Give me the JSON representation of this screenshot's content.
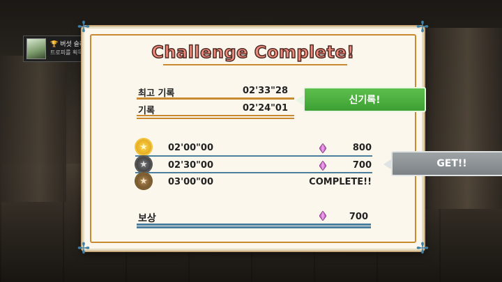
{
  "notification": {
    "trophy_name": "버섯 슬라이더",
    "message": "트로피를 획득했습니다!",
    "platform_badge": "PS"
  },
  "panel": {
    "title": "Challenge Complete!",
    "records": [
      {
        "label": "최고 기록",
        "time": "02'33\"28"
      },
      {
        "label": "기록",
        "time": "02'24\"01"
      }
    ],
    "tiers": [
      {
        "medal": "gold-star-medal",
        "time": "02'00\"00",
        "reward": "800",
        "show_gem": true
      },
      {
        "medal": "silver-star-medal",
        "time": "02'30\"00",
        "reward": "700",
        "show_gem": true
      },
      {
        "medal": "bronze-star-medal",
        "time": "03'00\"00",
        "reward": "COMPLETE!!",
        "show_gem": false
      }
    ],
    "reward": {
      "label": "보상",
      "value": "700"
    }
  },
  "callouts": {
    "new_record": "신기록!",
    "get": "GET!!"
  },
  "colors": {
    "title": "#f28a7e",
    "accent_orange": "#c98a2f",
    "accent_blue": "#4a7e9c",
    "new_record_bg": "#4cae40",
    "get_bg": "#8c9295",
    "gem": "#d06ad0"
  }
}
